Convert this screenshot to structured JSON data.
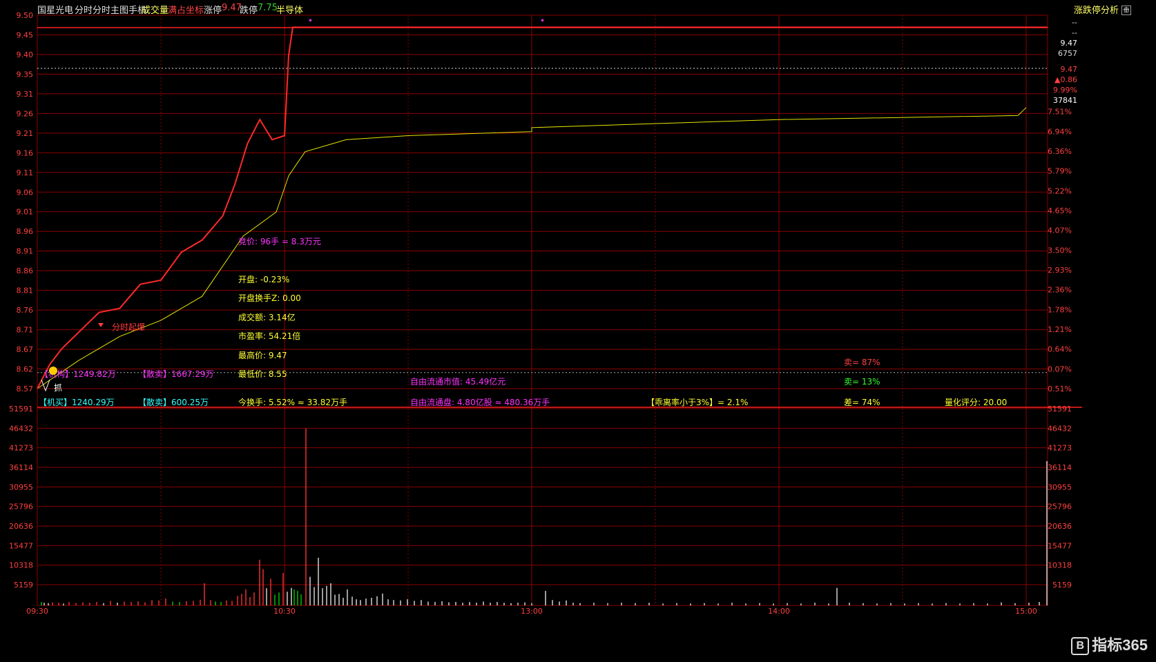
{
  "header": {
    "stock_name": "国星光电",
    "mode": "分时",
    "indicator": "分时主图手机",
    "volume_label": "成交量",
    "coord_label": "满占坐标",
    "limit_up_label": "涨停",
    "limit_up_value": "9.47",
    "limit_down_label": "跌停",
    "limit_down_value": "7.75",
    "sector": "半导体",
    "analysis_label": "涨跌停分析"
  },
  "right_info": [
    "--",
    "--",
    "9.47",
    "6757",
    "9.47",
    "▲0.86",
    "9.99%",
    "37841"
  ],
  "price_ticks": [
    "9.50",
    "9.45",
    "9.40",
    "9.35",
    "9.31",
    "9.26",
    "9.21",
    "9.16",
    "9.11",
    "9.06",
    "9.01",
    "8.96",
    "8.91",
    "8.86",
    "8.81",
    "8.76",
    "8.71",
    "8.67",
    "8.62",
    "8.57"
  ],
  "pct_ticks": [
    "7.51%",
    "6.94%",
    "6.36%",
    "5.79%",
    "5.22%",
    "4.65%",
    "4.07%",
    "3.50%",
    "2.93%",
    "2.36%",
    "1.78%",
    "1.21%",
    "0.64%",
    "0.07%",
    "0.51%"
  ],
  "volume_ticks": [
    "51591",
    "46432",
    "41273",
    "36114",
    "30955",
    "25796",
    "20636",
    "15477",
    "10318",
    "5159"
  ],
  "time_ticks": [
    "09:30",
    "10:30",
    "13:00",
    "14:00",
    "15:00"
  ],
  "annotations": {
    "auction": "竞价: 96手 = 8.3万元",
    "open": "开盘: -0.23%",
    "open_turnover": "开盘换手Z: 0.00",
    "amount": "成交额: 3.14亿",
    "pe": "市盈率: 54.21倍",
    "high": "最高价: 9.47",
    "low": "最低价: 8.55",
    "turnover": "今换手: 5.52% ≈ 33.82万手",
    "float_value": "自由流通市值: 45.49亿元",
    "float_shares": "自由流通盘: 4.80亿股 ≈ 480.36万手",
    "deviation": "【乖离率小于3%】= 2.1%",
    "sell_pct": "卖= 87%",
    "buy_pct": "卖= 13%",
    "diff_pct": "差= 74%",
    "score": "量化评分: 20.00",
    "retail_sell_1": "【散卖】1667.29万",
    "retail_sell_2": "【散卖】600.25万",
    "main_buy_1": "【机构】1249.82万",
    "main_buy_2": "【机买】1240.29万",
    "burst": "分时起爆",
    "grab": "抓"
  },
  "watermark": "指标365",
  "chart_data": {
    "type": "line",
    "title": "",
    "xlabel": "",
    "ylabel": "",
    "ylim": [
      8.55,
      9.5
    ],
    "series": [
      {
        "x": [
          "09:30",
          "09:33",
          "09:36",
          "09:40",
          "09:45",
          "09:50",
          "09:55",
          "10:00",
          "10:05",
          "10:10",
          "10:15",
          "10:18",
          "10:21",
          "10:24",
          "10:27",
          "10:30",
          "10:31",
          "10:32",
          "10:33",
          "10:34",
          "15:00"
        ],
        "values": [
          8.57,
          8.63,
          8.67,
          8.71,
          8.76,
          8.77,
          8.83,
          8.84,
          8.91,
          8.94,
          9.0,
          9.08,
          9.18,
          9.24,
          9.19,
          9.2,
          9.4,
          9.47,
          9.47,
          9.47,
          9.47
        ]
      },
      {
        "x": [
          "09:30",
          "09:40",
          "09:50",
          "10:00",
          "10:10",
          "10:20",
          "10:28",
          "10:31",
          "10:35",
          "10:45",
          "11:00",
          "11:30",
          "13:00",
          "14:00",
          "14:58",
          "15:00"
        ],
        "values": [
          8.57,
          8.64,
          8.7,
          8.74,
          8.8,
          8.95,
          9.01,
          9.1,
          9.16,
          9.19,
          9.2,
          9.21,
          9.22,
          9.24,
          9.25,
          9.27
        ]
      }
    ],
    "reference_price": 8.61,
    "volume": {
      "ylim": [
        0,
        51591
      ],
      "bars": [
        {
          "x": 60,
          "v": 900,
          "c": "g"
        },
        {
          "x": 64,
          "v": 700,
          "c": "w"
        },
        {
          "x": 70,
          "v": 600,
          "c": "w"
        },
        {
          "x": 76,
          "v": 800,
          "c": "r"
        },
        {
          "x": 85,
          "v": 700,
          "c": "r"
        },
        {
          "x": 92,
          "v": 500,
          "c": "w"
        },
        {
          "x": 100,
          "v": 900,
          "c": "r"
        },
        {
          "x": 110,
          "v": 600,
          "c": "r"
        },
        {
          "x": 120,
          "v": 800,
          "c": "r"
        },
        {
          "x": 130,
          "v": 700,
          "c": "r"
        },
        {
          "x": 140,
          "v": 900,
          "c": "r"
        },
        {
          "x": 150,
          "v": 600,
          "c": "w"
        },
        {
          "x": 160,
          "v": 1200,
          "c": "r"
        },
        {
          "x": 170,
          "v": 700,
          "c": "w"
        },
        {
          "x": 180,
          "v": 1000,
          "c": "r"
        },
        {
          "x": 190,
          "v": 900,
          "c": "r"
        },
        {
          "x": 200,
          "v": 1100,
          "c": "r"
        },
        {
          "x": 210,
          "v": 800,
          "c": "r"
        },
        {
          "x": 220,
          "v": 1400,
          "c": "r"
        },
        {
          "x": 230,
          "v": 1300,
          "c": "r"
        },
        {
          "x": 240,
          "v": 1800,
          "c": "r"
        },
        {
          "x": 250,
          "v": 1000,
          "c": "g"
        },
        {
          "x": 260,
          "v": 900,
          "c": "g"
        },
        {
          "x": 270,
          "v": 1100,
          "c": "r"
        },
        {
          "x": 280,
          "v": 1200,
          "c": "r"
        },
        {
          "x": 290,
          "v": 1500,
          "c": "r"
        },
        {
          "x": 296,
          "v": 5800,
          "c": "r"
        },
        {
          "x": 305,
          "v": 1400,
          "c": "r"
        },
        {
          "x": 312,
          "v": 1000,
          "c": "g"
        },
        {
          "x": 320,
          "v": 900,
          "c": "g"
        },
        {
          "x": 328,
          "v": 1300,
          "c": "r"
        },
        {
          "x": 336,
          "v": 1200,
          "c": "r"
        },
        {
          "x": 344,
          "v": 2500,
          "c": "r"
        },
        {
          "x": 350,
          "v": 3000,
          "c": "r"
        },
        {
          "x": 356,
          "v": 4200,
          "c": "r"
        },
        {
          "x": 362,
          "v": 2200,
          "c": "r"
        },
        {
          "x": 368,
          "v": 3400,
          "c": "r"
        },
        {
          "x": 376,
          "v": 12000,
          "c": "r"
        },
        {
          "x": 381,
          "v": 9500,
          "c": "r"
        },
        {
          "x": 386,
          "v": 4500,
          "c": "w"
        },
        {
          "x": 392,
          "v": 7000,
          "c": "r"
        },
        {
          "x": 398,
          "v": 2800,
          "c": "g"
        },
        {
          "x": 404,
          "v": 3400,
          "c": "g"
        },
        {
          "x": 410,
          "v": 8500,
          "c": "r"
        },
        {
          "x": 416,
          "v": 3600,
          "c": "w"
        },
        {
          "x": 422,
          "v": 4600,
          "c": "w"
        },
        {
          "x": 426,
          "v": 4200,
          "c": "g"
        },
        {
          "x": 431,
          "v": 3800,
          "c": "g"
        },
        {
          "x": 436,
          "v": 2900,
          "c": "g"
        },
        {
          "x": 443,
          "v": 46432,
          "c": "r"
        },
        {
          "x": 449,
          "v": 7500,
          "c": "w"
        },
        {
          "x": 455,
          "v": 4800,
          "c": "w"
        },
        {
          "x": 461,
          "v": 12500,
          "c": "w"
        },
        {
          "x": 467,
          "v": 4500,
          "c": "w"
        },
        {
          "x": 473,
          "v": 5100,
          "c": "w"
        },
        {
          "x": 479,
          "v": 5800,
          "c": "w"
        },
        {
          "x": 485,
          "v": 2800,
          "c": "w"
        },
        {
          "x": 491,
          "v": 3000,
          "c": "w"
        },
        {
          "x": 497,
          "v": 2000,
          "c": "w"
        },
        {
          "x": 503,
          "v": 4200,
          "c": "w"
        },
        {
          "x": 510,
          "v": 2300,
          "c": "w"
        },
        {
          "x": 516,
          "v": 1600,
          "c": "w"
        },
        {
          "x": 522,
          "v": 1400,
          "c": "w"
        },
        {
          "x": 530,
          "v": 1800,
          "c": "w"
        },
        {
          "x": 538,
          "v": 2000,
          "c": "w"
        },
        {
          "x": 546,
          "v": 2400,
          "c": "w"
        },
        {
          "x": 554,
          "v": 3100,
          "c": "w"
        },
        {
          "x": 562,
          "v": 1600,
          "c": "w"
        },
        {
          "x": 570,
          "v": 1400,
          "c": "w"
        },
        {
          "x": 580,
          "v": 1300,
          "c": "w"
        },
        {
          "x": 590,
          "v": 1600,
          "c": "w"
        },
        {
          "x": 600,
          "v": 1200,
          "c": "w"
        },
        {
          "x": 610,
          "v": 1400,
          "c": "w"
        },
        {
          "x": 620,
          "v": 1000,
          "c": "w"
        },
        {
          "x": 630,
          "v": 900,
          "c": "w"
        },
        {
          "x": 640,
          "v": 1100,
          "c": "w"
        },
        {
          "x": 650,
          "v": 800,
          "c": "w"
        },
        {
          "x": 660,
          "v": 900,
          "c": "w"
        },
        {
          "x": 670,
          "v": 700,
          "c": "w"
        },
        {
          "x": 680,
          "v": 900,
          "c": "w"
        },
        {
          "x": 690,
          "v": 700,
          "c": "w"
        },
        {
          "x": 700,
          "v": 1000,
          "c": "w"
        },
        {
          "x": 710,
          "v": 700,
          "c": "w"
        },
        {
          "x": 720,
          "v": 900,
          "c": "w"
        },
        {
          "x": 730,
          "v": 700,
          "c": "w"
        },
        {
          "x": 740,
          "v": 600,
          "c": "w"
        },
        {
          "x": 750,
          "v": 700,
          "c": "w"
        },
        {
          "x": 760,
          "v": 800,
          "c": "w"
        },
        {
          "x": 770,
          "v": 600,
          "c": "w"
        },
        {
          "x": 790,
          "v": 3800,
          "c": "w"
        },
        {
          "x": 800,
          "v": 1400,
          "c": "w"
        },
        {
          "x": 810,
          "v": 1000,
          "c": "w"
        },
        {
          "x": 820,
          "v": 1300,
          "c": "w"
        },
        {
          "x": 830,
          "v": 700,
          "c": "w"
        },
        {
          "x": 840,
          "v": 600,
          "c": "w"
        },
        {
          "x": 860,
          "v": 700,
          "c": "w"
        },
        {
          "x": 880,
          "v": 600,
          "c": "w"
        },
        {
          "x": 900,
          "v": 700,
          "c": "w"
        },
        {
          "x": 920,
          "v": 600,
          "c": "w"
        },
        {
          "x": 940,
          "v": 700,
          "c": "w"
        },
        {
          "x": 960,
          "v": 500,
          "c": "w"
        },
        {
          "x": 980,
          "v": 600,
          "c": "w"
        },
        {
          "x": 1000,
          "v": 500,
          "c": "w"
        },
        {
          "x": 1020,
          "v": 600,
          "c": "w"
        },
        {
          "x": 1040,
          "v": 500,
          "c": "w"
        },
        {
          "x": 1060,
          "v": 700,
          "c": "w"
        },
        {
          "x": 1080,
          "v": 500,
          "c": "w"
        },
        {
          "x": 1100,
          "v": 600,
          "c": "w"
        },
        {
          "x": 1120,
          "v": 500,
          "c": "w"
        },
        {
          "x": 1140,
          "v": 600,
          "c": "w"
        },
        {
          "x": 1160,
          "v": 500,
          "c": "w"
        },
        {
          "x": 1180,
          "v": 700,
          "c": "w"
        },
        {
          "x": 1200,
          "v": 500,
          "c": "w"
        },
        {
          "x": 1212,
          "v": 4600,
          "c": "w"
        },
        {
          "x": 1230,
          "v": 700,
          "c": "w"
        },
        {
          "x": 1250,
          "v": 600,
          "c": "w"
        },
        {
          "x": 1270,
          "v": 500,
          "c": "w"
        },
        {
          "x": 1290,
          "v": 600,
          "c": "w"
        },
        {
          "x": 1310,
          "v": 500,
          "c": "w"
        },
        {
          "x": 1330,
          "v": 600,
          "c": "w"
        },
        {
          "x": 1350,
          "v": 500,
          "c": "w"
        },
        {
          "x": 1370,
          "v": 600,
          "c": "w"
        },
        {
          "x": 1390,
          "v": 500,
          "c": "w"
        },
        {
          "x": 1410,
          "v": 600,
          "c": "w"
        },
        {
          "x": 1430,
          "v": 500,
          "c": "w"
        },
        {
          "x": 1450,
          "v": 800,
          "c": "w"
        },
        {
          "x": 1470,
          "v": 600,
          "c": "w"
        },
        {
          "x": 1490,
          "v": 700,
          "c": "w"
        },
        {
          "x": 1505,
          "v": 900,
          "c": "w"
        },
        {
          "x": 1516,
          "v": 37841,
          "c": "w"
        }
      ]
    }
  },
  "colors": {
    "grid": "#8b0000",
    "price_line": "#ff2a2a",
    "avg_line": "#e6e600",
    "up": "#ff3030",
    "down": "#00cc00",
    "flat": "#e0e0e0",
    "magenta": "#ff33ff",
    "yellow": "#ffff33",
    "cyan": "#33ffff"
  }
}
